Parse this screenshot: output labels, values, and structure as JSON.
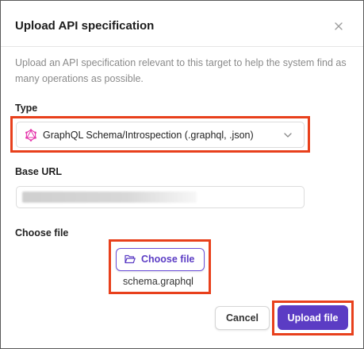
{
  "dialog": {
    "title": "Upload API specification",
    "description": "Upload an API specification relevant to this target to help the system find as many operations as possible."
  },
  "type_field": {
    "label": "Type",
    "selected_value": "GraphQL Schema/Introspection (.graphql, .json)",
    "icon": "graphql-icon"
  },
  "base_url_field": {
    "label": "Base URL",
    "value_state": "redacted"
  },
  "file_field": {
    "label": "Choose file",
    "button_label": "Choose file",
    "button_icon": "folder-open-icon",
    "file_name": "schema.graphql"
  },
  "actions": {
    "cancel_label": "Cancel",
    "upload_label": "Upload file"
  },
  "colors": {
    "accent": "#5b3cc4",
    "graphql": "#e535ab",
    "highlight": "#e8401c"
  }
}
